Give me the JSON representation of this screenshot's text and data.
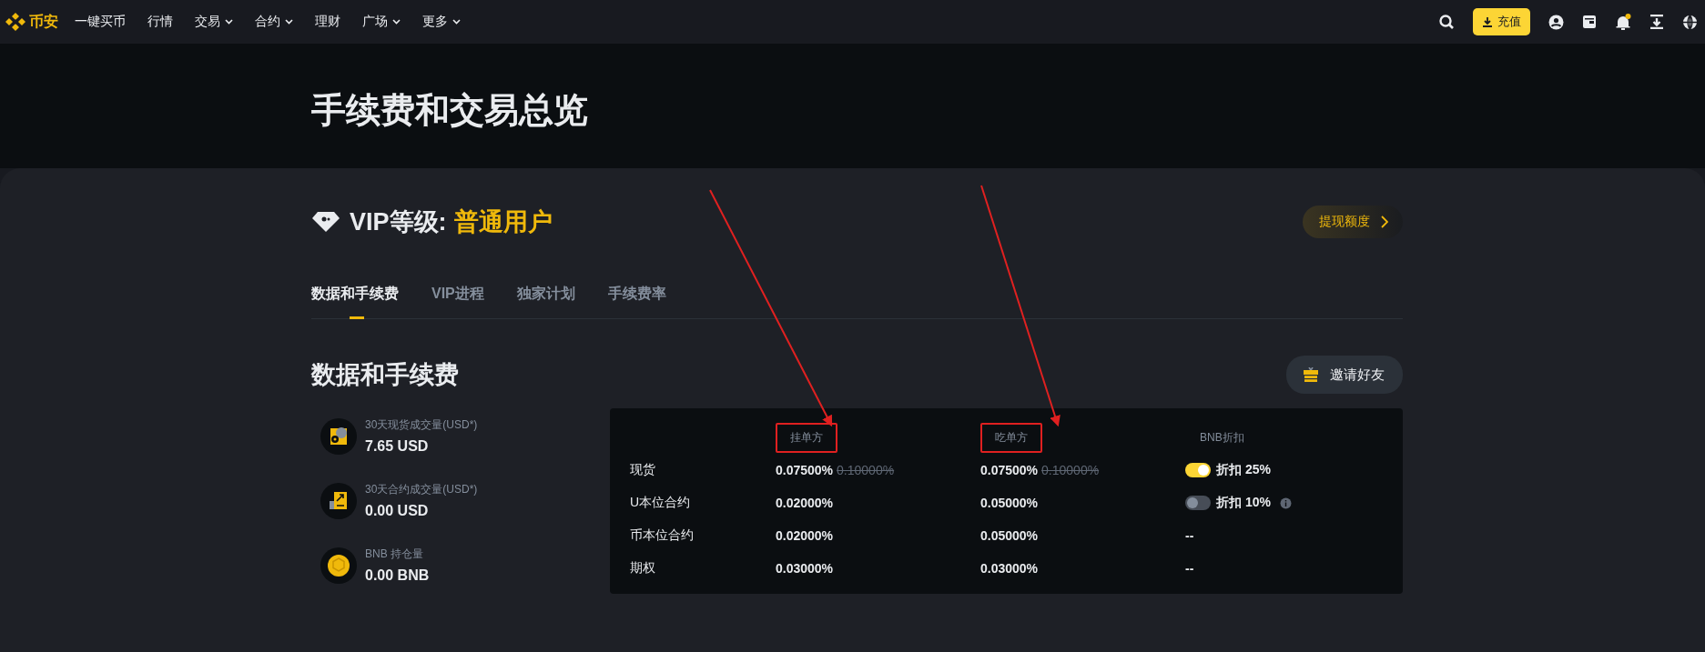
{
  "nav": {
    "brand": "币安",
    "items": [
      {
        "label": "一键买币",
        "dropdown": false
      },
      {
        "label": "行情",
        "dropdown": false
      },
      {
        "label": "交易",
        "dropdown": true
      },
      {
        "label": "合约",
        "dropdown": true
      },
      {
        "label": "理财",
        "dropdown": false
      },
      {
        "label": "广场",
        "dropdown": true
      },
      {
        "label": "更多",
        "dropdown": true
      }
    ],
    "deposit_button": "充值",
    "notification_dot": true
  },
  "page_title": "手续费和交易总览",
  "vip": {
    "label": "VIP等级:",
    "level": "普通用户",
    "withdraw_button": "提现额度"
  },
  "tabs": [
    {
      "label": "数据和手续费",
      "selected": true
    },
    {
      "label": "VIP进程",
      "selected": false
    },
    {
      "label": "独家计划",
      "selected": false
    },
    {
      "label": "手续费率",
      "selected": false
    }
  ],
  "section": {
    "title": "数据和手续费",
    "invite_button": "邀请好友"
  },
  "stats": [
    {
      "kind": "spot",
      "label": "30天现货成交量(USD*)",
      "value": "7.65 USD"
    },
    {
      "kind": "futures",
      "label": "30天合约成交量(USD*)",
      "value": "0.00 USD"
    },
    {
      "kind": "bnb",
      "label": "BNB 持仓量",
      "value": "0.00 BNB"
    }
  ],
  "fee_table": {
    "columns": [
      {
        "label": "挂单方",
        "highlighted": true
      },
      {
        "label": "吃单方",
        "highlighted": true
      },
      {
        "label": "BNB折扣",
        "highlighted": false
      }
    ],
    "rows": [
      {
        "name": "现货",
        "maker": "0.07500%",
        "maker_old": "0.10000%",
        "taker": "0.07500%",
        "taker_old": "0.10000%",
        "discount": {
          "kind": "toggle",
          "on": true,
          "label": "折扣 25%",
          "info": false
        }
      },
      {
        "name": "U本位合约",
        "maker": "0.02000%",
        "taker": "0.05000%",
        "discount": {
          "kind": "toggle",
          "on": false,
          "label": "折扣 10%",
          "info": true
        }
      },
      {
        "name": "币本位合约",
        "maker": "0.02000%",
        "taker": "0.05000%",
        "discount": {
          "kind": "text",
          "label": "--"
        }
      },
      {
        "name": "期权",
        "maker": "0.03000%",
        "taker": "0.03000%",
        "discount": {
          "kind": "text",
          "label": "--"
        }
      }
    ]
  }
}
